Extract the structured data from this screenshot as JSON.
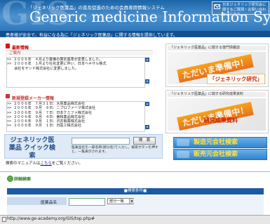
{
  "header": {
    "watermark": "GIS",
    "subtitle": "「ジェネリック医薬品」の普及促進のための会員専用情報システム",
    "title": "Generic medicine Information System",
    "contact": "日本ジェネリック研究会に関するご質問・お問い合わせはこちら",
    "tagline": "患者様が安全で、有益になる為に「ジェネリック医薬品」に関する情報を提供しています。"
  },
  "notice": {
    "title": "最新情報",
    "guide_label": "ご案内",
    "lines": [
      ">> ２００６年　４月より薬価の算定基準が変更しました。",
      ">> ２００６年　１月より社名変更に伴い、日本ヘキサル株式",
      "　　会社をサンド株式会社に変更しました。"
    ]
  },
  "new_makers": {
    "title": "新規登録メーカー情報",
    "lines": [
      ">> ２００６年　７月３１日：大原薬品株式会社",
      ">> ２００６年　９月　９日：ニプロファーマ株式会社",
      ">> ２００６年　９月　７日：日本ケミファ株式会社",
      ">> ２００６年　９月　４日：東和薬品株式会社",
      ">> ２００６年　９月　１日：沢井製薬株式会社",
      ">> ２００６年　９月　１日：日医工株式会社"
    ]
  },
  "banners": [
    {
      "head": "「ジェネリック医薬品」に関する専門情報誌",
      "stamp": "ただいま準備中！",
      "sub": "「ジェネリック研究」"
    },
    {
      "head": "「ジェネリック医薬品」に関する研究成果資料",
      "stamp": "ただいま準備中！",
      "sub": "研究成果資料"
    }
  ],
  "quick_search": {
    "title": "ジェネリック医薬品 クイック検索",
    "button": "検　索",
    "note": "医薬品名を一部名称(部分名)で入力し、検索ボタンを押すと、一覧表示されます。",
    "manual_prefix": "検索のマニュアルは",
    "manual_link": "こちら",
    "manual_suffix": "をご覧ください。"
  },
  "side_buttons": {
    "maker": "製造元会社検索",
    "seller": "販売元会社検索"
  },
  "detail_search": {
    "title": "詳細検索",
    "cond_header": "■検索条件■",
    "name_label": "医薬品名",
    "match_option": "部分一致"
  },
  "status": {
    "url": "http://www.ge-academy.org/GIS/top.php#"
  }
}
